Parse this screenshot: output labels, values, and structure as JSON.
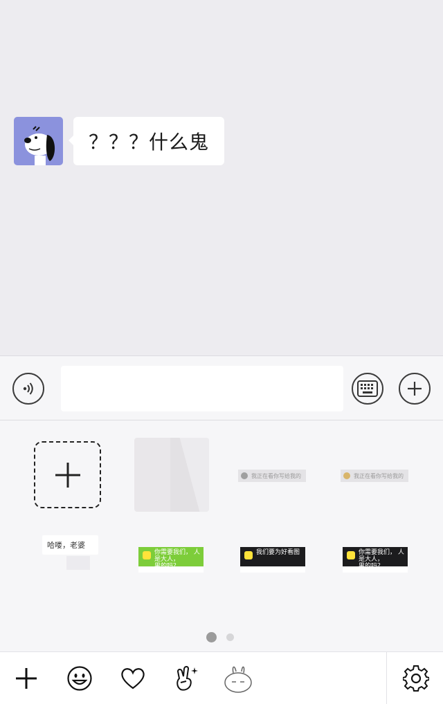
{
  "chat": {
    "messages": [
      {
        "sender_avatar": "snoopy-avatar",
        "text": "？？？什么鬼"
      }
    ]
  },
  "input_bar": {
    "voice_icon": "voice-wave-icon",
    "text_value": "",
    "keyboard_icon": "keyboard-icon",
    "plus_icon": "plus-circle-icon"
  },
  "sticker_panel": {
    "add_icon": "plus-icon",
    "items": [
      {
        "kind": "blank-thumbnail"
      },
      {
        "kind": "bar-thumbnail",
        "text": "我正在看你写给我的"
      },
      {
        "kind": "bar-thumbnail",
        "text": "我正在看你写给我的"
      },
      {
        "kind": "text-sticker",
        "text": "哈喽，老婆"
      },
      {
        "kind": "card",
        "color": "#7dcd3a",
        "title": "你需要我们，",
        "extra": "人是大人，",
        "line2": "男的吗？"
      },
      {
        "kind": "card",
        "color": "#1c1c1e",
        "title": "我们要为好看图",
        "extra": "",
        "line2": ""
      },
      {
        "kind": "card",
        "color": "#1c1c1e",
        "title": "你需要我们，",
        "extra": "人是大人，",
        "line2": "男的吗？"
      }
    ],
    "page_indicator": {
      "current": 1,
      "total": 2
    }
  },
  "toolbar": {
    "items": [
      "add-icon",
      "emoji-icon",
      "heart-icon",
      "peace-hand-icon",
      "bunny-icon",
      "settings-icon"
    ]
  },
  "colors": {
    "chat_background": "#edecf0",
    "avatar_background": "#8b92dd",
    "bubble": "#ffffff",
    "card_green": "#7dcd3a",
    "card_black": "#1c1c1e"
  }
}
